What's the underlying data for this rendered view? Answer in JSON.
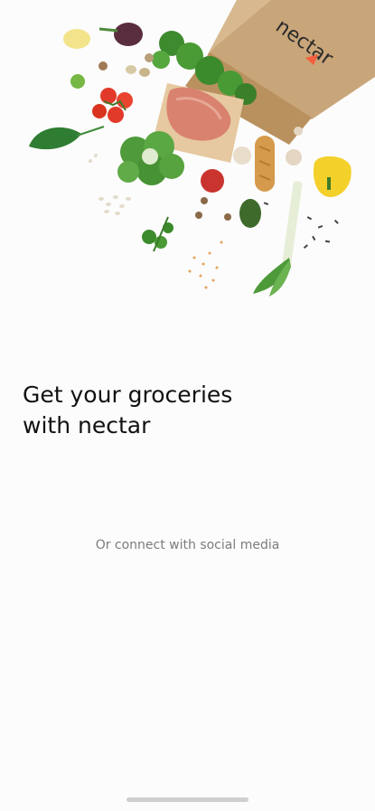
{
  "hero": {
    "bag_brand": "nectar",
    "image_subject": "grocery-bag-illustration"
  },
  "onboarding": {
    "headline_line1": "Get your groceries",
    "headline_line2": "with nectar",
    "social_prompt": "Or connect with social media"
  },
  "colors": {
    "background": "#fcfcfc",
    "text_primary": "#111111",
    "text_secondary": "#7c7c7c",
    "brand_accent": "#53b175",
    "carrot_orange": "#f3603f"
  },
  "icons": {
    "home_indicator": "home-indicator-bar"
  }
}
